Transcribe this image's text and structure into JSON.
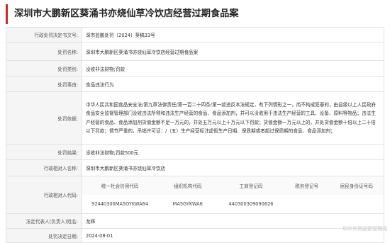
{
  "title": "深圳市大鹏新区葵涌书亦烧仙草冷饮店经营过期食品案",
  "rows": {
    "doc_no": {
      "label": "行政处罚决定书文号:",
      "value": "深市监鹏处罚〔2024〕葵稿33号"
    },
    "case_name": {
      "label": "处罚名称:",
      "value": "深圳市大鹏新区葵涌书亦烧仙草冷饮店经营过期食品案"
    },
    "category": {
      "label": "处罚类别:",
      "value": "没收非法财物;罚款"
    },
    "reason": {
      "label": "处罚事由:",
      "value": "食品违法行为"
    },
    "basis": {
      "label": "处罚依据:",
      "value": "中华人民共和国食品安全法/第九章法律责任/第一百二十四条/第一款违反本法规定，有下列情形之一，尚不构成犯罪的，由县级以上人民政府食品安全监督管理部门没收违法所得和违法生产经营的食品、食品添加剂，并可以没收用于违法生产经营的工具、设备、原料等物品；违法生产经营的食品、食品添加剂货值金额不足一万元的，并处五万元以上十万元以下罚款；货值金额一万元以上的，并处货值金额十倍以上二十倍以下罚款；情节严重的，吊销许可证：/（五）生产经营标注虚假生产日期、保质期或者超过保质期的食品、食品添加剂；"
    },
    "result": {
      "label": "处罚结果:",
      "value": "没收非法财物;罚款500元"
    },
    "party": {
      "label": "行政相对人名称:",
      "value": "深圳市大鹏新区葵涌书亦烧仙草冷饮店"
    },
    "codes": {
      "label": "行政相对人代码:",
      "headers": [
        "统一社会信用代码",
        "组织机构代码",
        "工商登记码",
        "税务登记号",
        "居民身份证号码"
      ],
      "values": [
        "92440300MA5GYKWA64",
        "MA5GYKWA6",
        "440300309090626",
        "",
        ""
      ]
    },
    "legal_rep": {
      "label": "法定代表人(负责人)姓名:",
      "value": "龙辉"
    },
    "decision_date": {
      "label": "处罚决定日期:",
      "value": "2024-08-01"
    }
  },
  "watermark": "圳市市场监督管理局"
}
